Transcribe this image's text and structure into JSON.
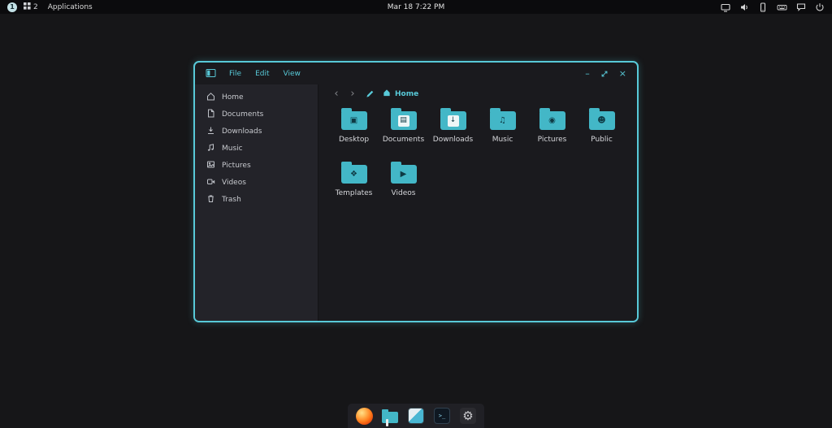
{
  "panel": {
    "workspace": "1",
    "indicator_count": "2",
    "applications_label": "Applications",
    "clock": "Mar 18 7:22 PM",
    "tray_icons": [
      "projector-icon",
      "volume-icon",
      "tablet-icon",
      "keyboard-icon",
      "chat-icon",
      "power-icon"
    ]
  },
  "window": {
    "app": "file-manager",
    "menus": [
      "File",
      "Edit",
      "View"
    ],
    "controls": {
      "minimize": "–",
      "close": "×"
    },
    "toolbar": {
      "back": "‹",
      "forward": "›"
    },
    "breadcrumb": {
      "location": "Home"
    },
    "sidebar": [
      {
        "label": "Home",
        "icon": "home-icon"
      },
      {
        "label": "Documents",
        "icon": "document-icon"
      },
      {
        "label": "Downloads",
        "icon": "download-icon"
      },
      {
        "label": "Music",
        "icon": "music-icon"
      },
      {
        "label": "Pictures",
        "icon": "pictures-icon"
      },
      {
        "label": "Videos",
        "icon": "videos-icon"
      },
      {
        "label": "Trash",
        "icon": "trash-icon"
      }
    ],
    "folders": [
      {
        "label": "Desktop",
        "emblem": "▣"
      },
      {
        "label": "Documents",
        "emblem": "▤"
      },
      {
        "label": "Downloads",
        "emblem": "↓"
      },
      {
        "label": "Music",
        "emblem": "♫"
      },
      {
        "label": "Pictures",
        "emblem": "◉"
      },
      {
        "label": "Public",
        "emblem": "☻"
      },
      {
        "label": "Templates",
        "emblem": "❖"
      },
      {
        "label": "Videos",
        "emblem": "▶"
      }
    ]
  },
  "dock": {
    "items": [
      "firefox",
      "file-manager",
      "editor",
      "terminal",
      "settings"
    ],
    "terminal_glyph": ">_",
    "gear_glyph": "⚙"
  },
  "colors": {
    "accent": "#58c9d8",
    "folder": "#43b7c7",
    "panel_bg": "#0b0b0d",
    "desktop_bg": "#161618",
    "window_bg": "#1a1a1e",
    "sidebar_bg": "#232329",
    "text": "#d6d7db"
  }
}
